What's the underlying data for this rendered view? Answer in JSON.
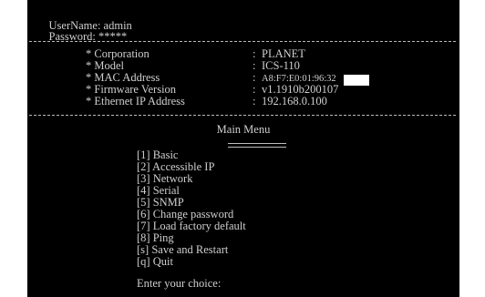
{
  "login": {
    "username_label": "UserName:",
    "username_value": "admin",
    "password_label": "Password:",
    "password_value": "*****"
  },
  "info": [
    {
      "label": "* Corporation",
      "value": "PLANET"
    },
    {
      "label": "* Model",
      "value": "ICS-110"
    },
    {
      "label": "* MAC Address",
      "value": "A8:F7:E0:01:96:32"
    },
    {
      "label": "* Firmware Version",
      "value": "v1.1910b200107"
    },
    {
      "label": "* Ethernet IP Address",
      "value": "192.168.0.100"
    }
  ],
  "colon": ":",
  "menu": {
    "title": "Main Menu",
    "items": [
      {
        "key": "[1]",
        "label": "Basic"
      },
      {
        "key": "[2]",
        "label": "Accessible IP"
      },
      {
        "key": "[3]",
        "label": "Network"
      },
      {
        "key": "[4]",
        "label": "Serial"
      },
      {
        "key": "[5]",
        "label": "SNMP"
      },
      {
        "key": "[6]",
        "label": "Change password"
      },
      {
        "key": "[7]",
        "label": "Load factory default"
      },
      {
        "key": "[8]",
        "label": "Ping"
      },
      {
        "key": "[s]",
        "label": "Save and Restart"
      },
      {
        "key": "[q]",
        "label": "Quit"
      }
    ],
    "prompt": "Enter your choice:"
  },
  "colors": {
    "background": "#000000",
    "text": "#cfcfcf"
  }
}
